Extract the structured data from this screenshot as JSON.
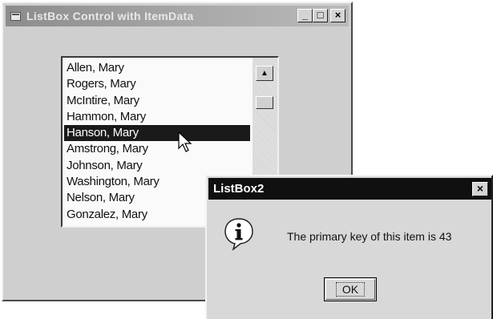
{
  "main_window": {
    "title": "ListBox Control with ItemData",
    "buttons": {
      "minimize": "_",
      "maximize": "□",
      "close": "×"
    }
  },
  "listbox": {
    "items": [
      "Allen, Mary",
      "Rogers, Mary",
      "McIntire, Mary",
      "Hammon, Mary",
      "Hanson, Mary",
      "Amstrong, Mary",
      "Johnson, Mary",
      "Washington, Mary",
      "Nelson, Mary",
      "Gonzalez, Mary"
    ],
    "selected_index": 4,
    "scroll_up_glyph": "▲"
  },
  "dialog": {
    "title": "ListBox2",
    "close": "×",
    "icon": "information-icon",
    "message": "The primary key of this item is 43",
    "ok_label": "OK"
  }
}
